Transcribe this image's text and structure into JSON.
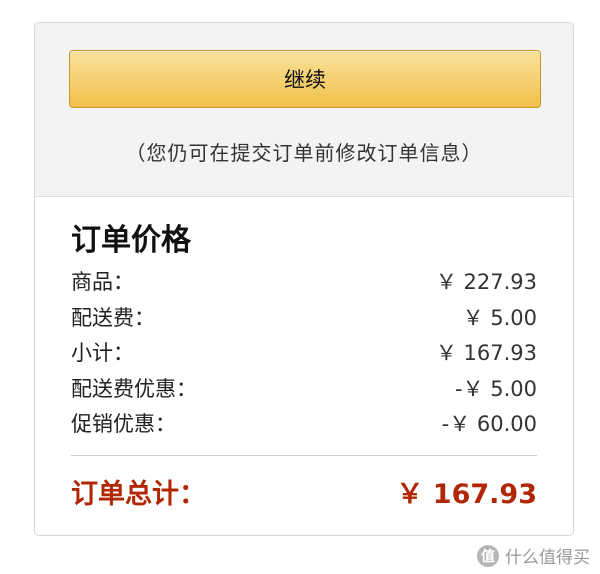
{
  "actions": {
    "continue_label": "继续",
    "hint": "（您仍可在提交订单前修改订单信息）"
  },
  "order_summary": {
    "title": "订单价格",
    "rows": [
      {
        "label": "商品：",
        "value": "￥ 227.93"
      },
      {
        "label": "配送费：",
        "value": "￥ 5.00"
      },
      {
        "label": "小计：",
        "value": "￥ 167.93"
      },
      {
        "label": "配送费优惠：",
        "value": "-￥ 5.00"
      },
      {
        "label": "促销优惠：",
        "value": "-￥ 60.00"
      }
    ],
    "total_label": "订单总计：",
    "total_value": "￥ 167.93"
  },
  "watermark": {
    "logo_glyph": "值",
    "text": "什么值得买"
  },
  "colors": {
    "button_top": "#f9e19b",
    "button_bottom": "#f0c14b",
    "total_red": "#b12704"
  }
}
